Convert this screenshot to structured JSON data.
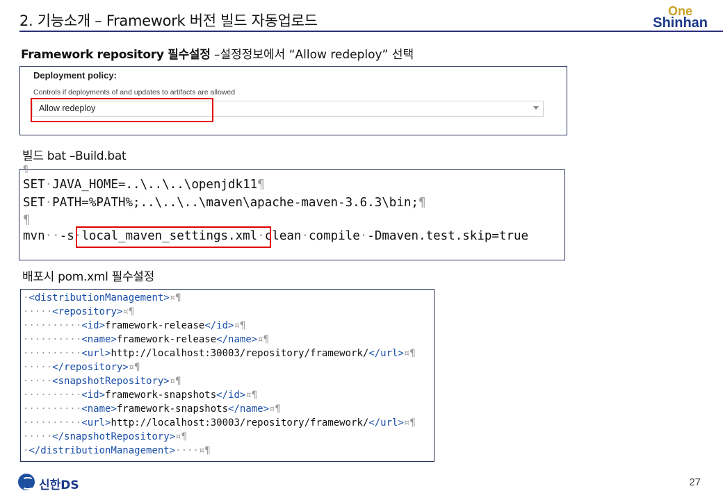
{
  "header": {
    "title": "2. 기능소개 – Framework 버전 빌드 자동업로드",
    "logo_one": "One",
    "logo_shinhan": "Shinhan"
  },
  "section1": {
    "heading_bold": "Framework repository 필수설정",
    "heading_desc": " –설정정보에서 “Allow redeploy”  선택",
    "policy_title": "Deployment policy:",
    "policy_help": "Controls if deployments of and updates to artifacts are allowed",
    "policy_value": "Allow redeploy"
  },
  "section2": {
    "heading": "빌드 bat –Build.bat",
    "lines": [
      "¶",
      "SET·JAVA_HOME=..\\..\\..\\openjdk11¶",
      "SET·PATH=%PATH%;..\\..\\..\\maven\\apache-maven-3.6.3\\bin;¶",
      "¶",
      "mvn··-s·local_maven_settings.xml·clean·compile·-Dmaven.test.skip=true"
    ]
  },
  "section3": {
    "heading": "배포시 pom.xml 필수설정",
    "xml_lines": [
      "·<distributionManagement>¤¶",
      "·····<repository>¤¶",
      "··········<id>framework-release</id>¤¶",
      "··········<name>framework-release</name>¤¶",
      "··········<url>http://localhost:30003/repository/framework/</url>¤¶",
      "·····</repository>¤¶",
      "·····<snapshotRepository>¤¶",
      "··········<id>framework-snapshots</id>¤¶",
      "··········<name>framework-snapshots</name>¤¶",
      "··········<url>http://localhost:30003/repository/framework/</url>¤¶",
      "·····</snapshotRepository>¤¶",
      "·</distributionManagement>····¤¶"
    ]
  },
  "footer": {
    "brand": "신한DS",
    "page_number": "27"
  },
  "colors": {
    "highlight": "#e00000",
    "brand_blue": "#1b3a8a",
    "brand_gold": "#c9a227"
  }
}
